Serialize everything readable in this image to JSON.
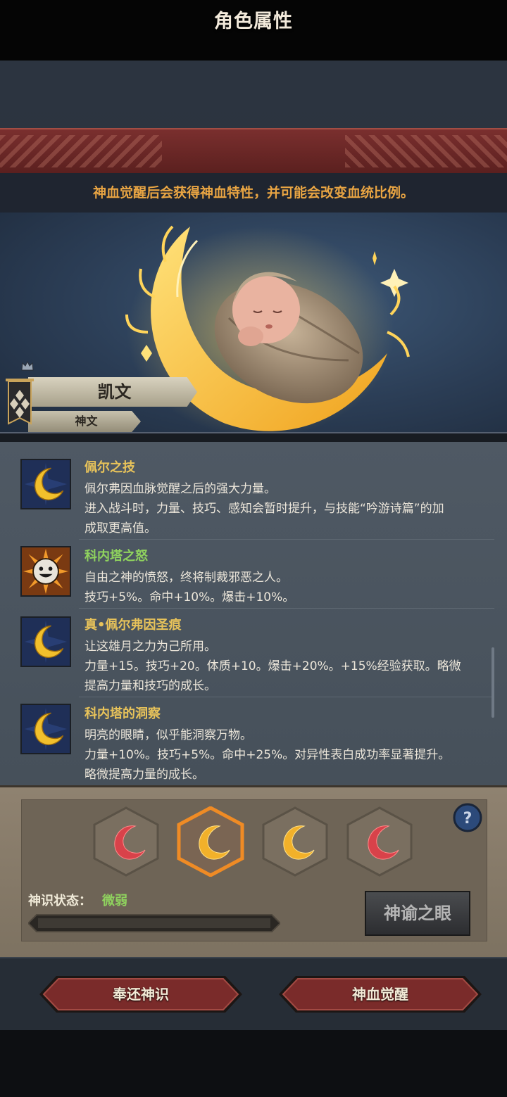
{
  "header": {
    "title": "角色属性",
    "subtitle": "神血觉醒后会获得神血特性，并可能会改变血统比例。"
  },
  "character": {
    "name": "凯文",
    "subname": "神文"
  },
  "skills": [
    {
      "icon": "crescent-moon-icon",
      "name": "佩尔之技",
      "lines": [
        "佩尔弗因血脉觉醒之后的强大力量。",
        "进入战斗时，力量、技巧、感知会暂时提升，与技能“吟游诗篇”的加",
        "成取更高值。"
      ]
    },
    {
      "icon": "sun-face-icon",
      "name": "科内塔之怒",
      "lines": [
        "自由之神的愤怒，终将制裁邪恶之人。",
        "技巧+5%。命中+10%。爆击+10%。"
      ]
    },
    {
      "icon": "crescent-moon-icon",
      "name": "真•佩尔弗因圣痕",
      "lines": [
        "让这雄月之力为己所用。",
        "力量+15。技巧+20。体质+10。爆击+20%。+15%经验获取。略微",
        "提高力量和技巧的成长。"
      ]
    },
    {
      "icon": "crescent-moon-icon",
      "name": "科内塔的洞察",
      "lines": [
        "明亮的眼睛，似乎能洞察万物。",
        "力量+10%。技巧+5%。命中+25%。对异性表白成功率显著提升。",
        "略微提高力量的成长。"
      ]
    }
  ],
  "runes": [
    {
      "icon": "red-crescent-icon",
      "color": "#d8424a"
    },
    {
      "icon": "gold-crescent-icon",
      "color": "#f2b12a",
      "selected": true
    },
    {
      "icon": "gold-crescent-icon",
      "color": "#f2b12a"
    },
    {
      "icon": "red-crescent-icon",
      "color": "#d8424a"
    }
  ],
  "status": {
    "label": "神识状态：",
    "value": "微弱",
    "progress": 0.0
  },
  "buttons": {
    "oracle": "神谕之眼",
    "return": "奉还神识",
    "awaken": "神血觉醒"
  },
  "colors": {
    "accent_gold": "#e8c35a",
    "accent_green": "#8fd25e",
    "title_red": "#6a2626"
  }
}
